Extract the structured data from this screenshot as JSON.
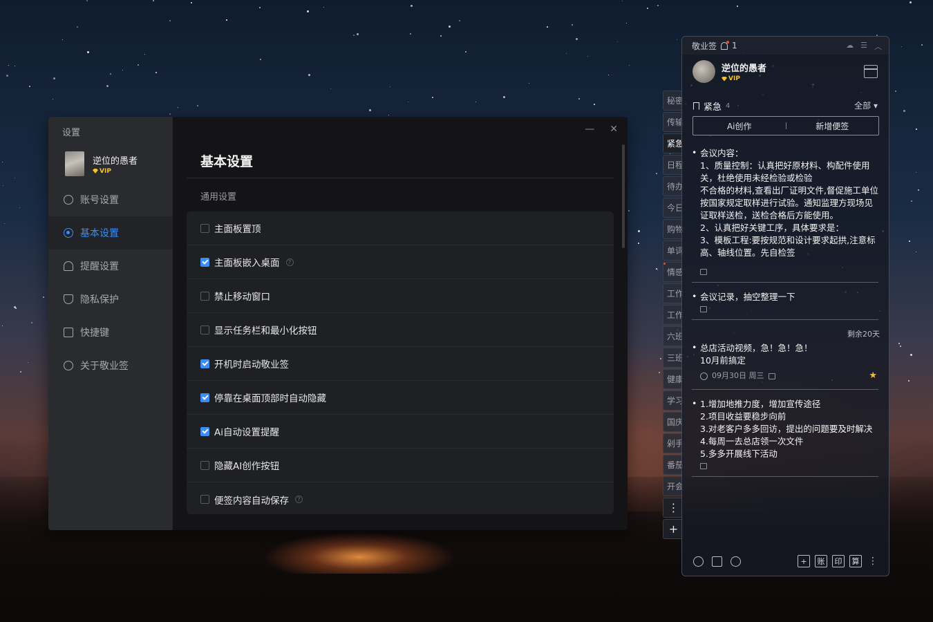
{
  "settings": {
    "title": "设置",
    "user": {
      "name": "逆位的愚者",
      "badge": "VIP"
    },
    "nav": [
      {
        "label": "账号设置",
        "icon": "user-icon"
      },
      {
        "label": "基本设置",
        "icon": "settings-icon"
      },
      {
        "label": "提醒设置",
        "icon": "bell-icon"
      },
      {
        "label": "隐私保护",
        "icon": "shield-icon"
      },
      {
        "label": "快捷键",
        "icon": "keyboard-icon"
      },
      {
        "label": "关于敬业签",
        "icon": "info-icon"
      }
    ],
    "window_controls": {
      "minimize": "—",
      "close": "✕"
    },
    "page_title": "基本设置",
    "section_label": "通用设置",
    "options": [
      {
        "label": "主面板置顶",
        "checked": false
      },
      {
        "label": "主面板嵌入桌面",
        "checked": true,
        "help": true
      },
      {
        "label": "禁止移动窗口",
        "checked": false
      },
      {
        "label": "显示任务栏和最小化按钮",
        "checked": false
      },
      {
        "label": "开机时启动敬业签",
        "checked": true
      },
      {
        "label": "停靠在桌面顶部时自动隐藏",
        "checked": true
      },
      {
        "label": "Ai自动设置提醒",
        "checked": true
      },
      {
        "label": "隐藏AI创作按钮",
        "checked": false
      },
      {
        "label": "便签内容自动保存",
        "checked": false,
        "help": true
      }
    ],
    "help_glyph": "?"
  },
  "tabs": [
    "秘密",
    "传输",
    "紧急",
    "日程",
    "待办",
    "今日",
    "购物",
    "单词",
    "情感",
    "工作",
    "工作",
    "六班",
    "三班",
    "健康",
    "学习",
    "国庆",
    "剁手",
    "番茄",
    "开会"
  ],
  "tab_buttons": {
    "more": "⋮",
    "add": "+"
  },
  "panel": {
    "app_name": "敬业签",
    "notify_count": "1",
    "user": {
      "name": "逆位的愚者",
      "badge": "VIP"
    },
    "section": {
      "label": "紧急",
      "count": "4"
    },
    "filter": "全部 ▾",
    "buttons": {
      "ai_create": "Ai创作",
      "new_note": "新增便签"
    },
    "notes": [
      {
        "text": "会议内容：\n1、质量控制：认真把好原材料、构配件使用关，杜绝使用未经检验或检验\n不合格的材料,查看出厂证明文件,督促施工单位按国家规定取样进行试验。通知监理方现场见证取样送检，送检合格后方能使用。\n2、认真把好关键工序，具体要求是：\n3、模板工程:要按规范和设计要求起拱,注意标高、轴线位置。先自检签"
      },
      {
        "text": "会议记录，抽空整理一下"
      },
      {
        "remaining": "剩余20天",
        "text": "总店活动视频，急！急！急！\n10月前搞定",
        "date": "09月30日 周三"
      },
      {
        "text": "1.增加地推力度，增加宣传途径\n2.项目收益要稳步向前\n3.对老客户多多回访，提出的问题要及时解决\n4.每周一去总店领一次文件\n5.多多开展线下活动"
      }
    ],
    "footer": {
      "boxes": [
        "+",
        "账",
        "印",
        "算"
      ],
      "more": "⋮"
    }
  }
}
